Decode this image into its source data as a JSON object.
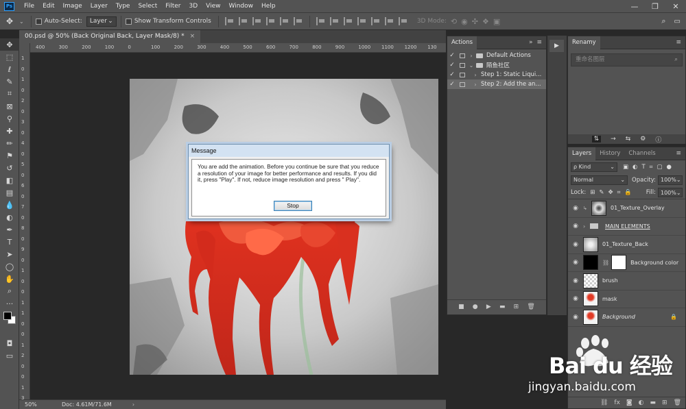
{
  "menubar": {
    "logo": "Ps",
    "items": [
      "File",
      "Edit",
      "Image",
      "Layer",
      "Type",
      "Select",
      "Filter",
      "3D",
      "View",
      "Window",
      "Help"
    ]
  },
  "options": {
    "auto_select_label": "Auto-Select:",
    "auto_select_target": "Layer",
    "show_transform_label": "Show Transform Controls",
    "mode_3d_label": "3D Mode:"
  },
  "document": {
    "tab_title": "00.psd @ 50% (Back Original Back, Layer Mask/8) *",
    "zoom": "50%",
    "doc_info": "Doc: 4.61M/71.6M",
    "ruler_h": [
      "400",
      "300",
      "200",
      "100",
      "0",
      "100",
      "200",
      "300",
      "400",
      "500",
      "600",
      "700",
      "800",
      "900",
      "1000",
      "1100",
      "1200",
      "130"
    ],
    "ruler_v": [
      "1",
      "0",
      "1",
      "0",
      "2",
      "0",
      "3",
      "0",
      "4",
      "0",
      "5",
      "0",
      "6",
      "0",
      "7",
      "0",
      "8",
      "0",
      "9",
      "0",
      "1",
      "0",
      "0",
      "1",
      "1",
      "0",
      "0",
      "1",
      "2",
      "0",
      "0",
      "1",
      "3"
    ]
  },
  "dialog": {
    "title": "Message",
    "message": "You are add the animation. Before you continue be sure that you reduce a resolution of your image for better performance and results. If you did it, press \"Play\". If not, reduce image resolution and press \" Play\".",
    "button": "Stop"
  },
  "actions_panel": {
    "tab": "Actions",
    "rows": [
      {
        "check": "✓",
        "arrow": "›",
        "label": "Default Actions",
        "folder": true,
        "selected": false
      },
      {
        "check": "✓",
        "arrow": "⌄",
        "label": "陌鱼社区",
        "folder": true,
        "selected": false
      },
      {
        "check": "✓",
        "arrow": "›",
        "label": "Step 1: Static Liqui...",
        "folder": false,
        "selected": false
      },
      {
        "check": "✓",
        "arrow": "›",
        "label": "Step 2: Add the an...",
        "folder": false,
        "selected": true
      }
    ]
  },
  "renamy_panel": {
    "tab": "Renamy",
    "search_placeholder": "重命名图层"
  },
  "layers_panel": {
    "tabs": [
      "Layers",
      "History",
      "Channels"
    ],
    "kind_label": "ρ Kind",
    "blend_mode": "Normal",
    "opacity_label": "Opacity:",
    "opacity_value": "100%",
    "lock_label": "Lock:",
    "fill_label": "Fill:",
    "fill_value": "100%",
    "layers": [
      {
        "name": "01_Texture_Overlay",
        "thumb": "texture-dark"
      },
      {
        "name": "MAIN ELEMENTS",
        "thumb": "folder"
      },
      {
        "name": "01_Texture_Back",
        "thumb": "texture-light"
      },
      {
        "name": "Background color",
        "thumb": "black"
      },
      {
        "name": "brush",
        "thumb": "checker"
      },
      {
        "name": "mask",
        "thumb": "red-flower"
      },
      {
        "name": "Background",
        "thumb": "red-flower"
      }
    ]
  },
  "watermark": {
    "brand": "Bai du 经验",
    "url": "jingyan.baidu.com"
  },
  "colors": {
    "panel_bg": "#535353",
    "dark_bg": "#282828",
    "accent_blue": "#2ea1ff",
    "flower_red": "#e23a25"
  }
}
